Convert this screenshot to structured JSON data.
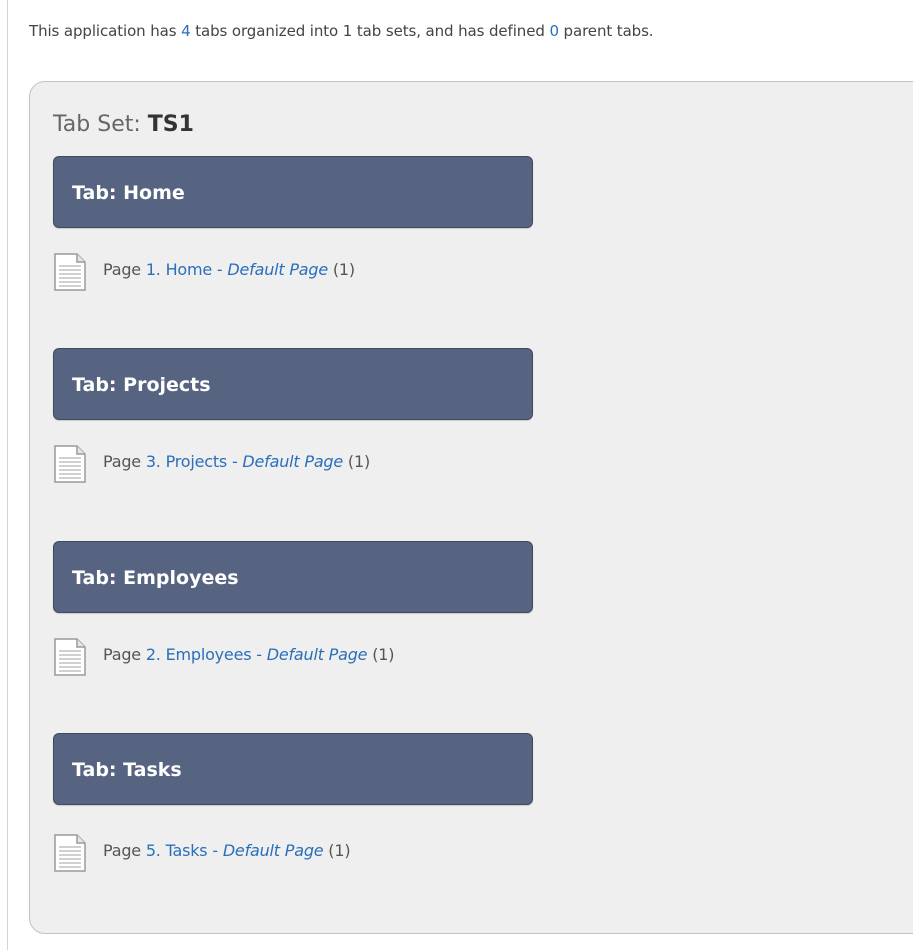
{
  "summary": {
    "prefix": "This application has ",
    "tab_count": "4",
    "middle": " tabs organized into 1 tab sets, and has defined ",
    "parent_count": "0",
    "suffix": " parent tabs."
  },
  "tabset": {
    "label": "Tab Set: ",
    "name": "TS1"
  },
  "tabs": [
    {
      "header": "Tab: Home",
      "page_prefix": "Page ",
      "page_link": "1. Home",
      "separator": " - ",
      "default_label": "Default Page",
      "count": " (1)"
    },
    {
      "header": "Tab: Projects",
      "page_prefix": "Page ",
      "page_link": "3. Projects",
      "separator": " - ",
      "default_label": "Default Page",
      "count": " (1)"
    },
    {
      "header": "Tab: Employees",
      "page_prefix": "Page ",
      "page_link": "2. Employees",
      "separator": " - ",
      "default_label": "Default Page",
      "count": " (1)"
    },
    {
      "header": "Tab: Tasks",
      "page_prefix": "Page ",
      "page_link": "5. Tasks",
      "separator": " - ",
      "default_label": "Default Page",
      "count": " (1)"
    }
  ],
  "icons": {
    "page": "page-icon"
  },
  "colors": {
    "tab_header_bg": "#566481",
    "link": "#2a6fba",
    "panel_bg": "#efefef"
  }
}
